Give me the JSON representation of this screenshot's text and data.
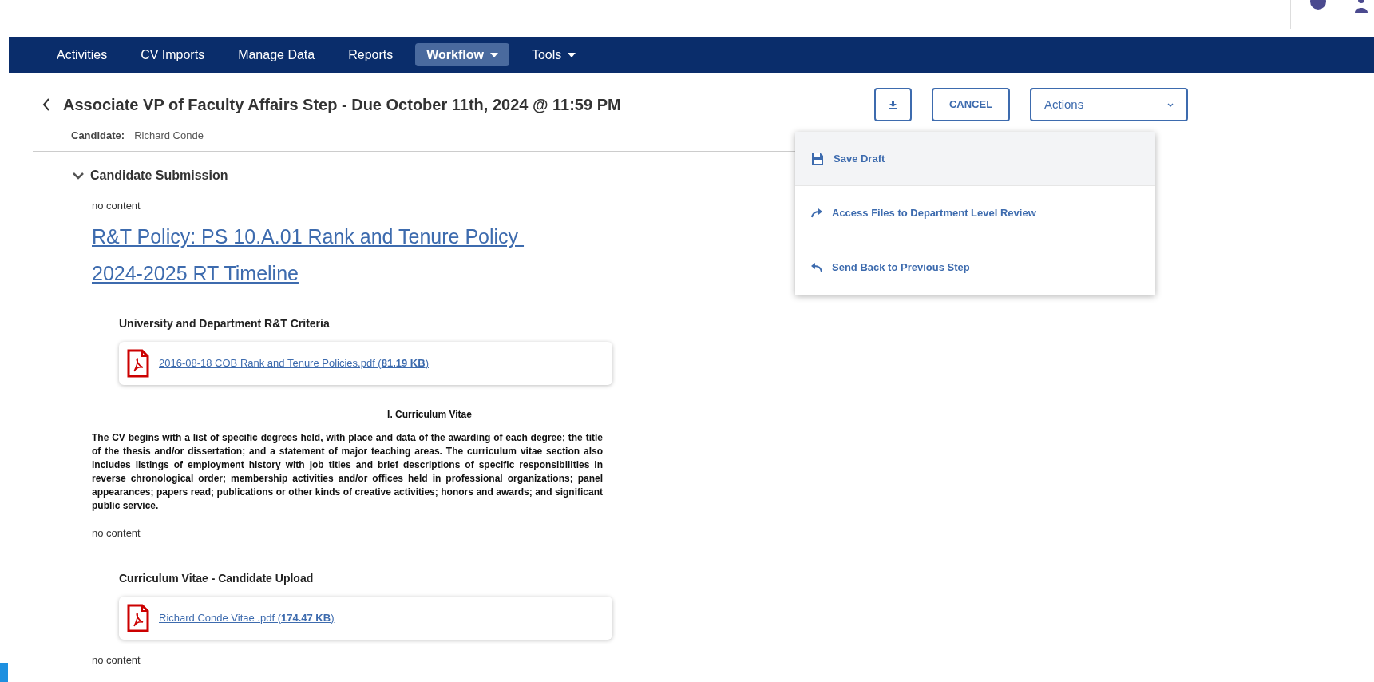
{
  "nav": {
    "items": [
      {
        "label": "Activities",
        "selected": false,
        "dropdown": false
      },
      {
        "label": "CV Imports",
        "selected": false,
        "dropdown": false
      },
      {
        "label": "Manage Data",
        "selected": false,
        "dropdown": false
      },
      {
        "label": "Reports",
        "selected": false,
        "dropdown": false
      },
      {
        "label": "Workflow",
        "selected": true,
        "dropdown": true
      },
      {
        "label": "Tools",
        "selected": false,
        "dropdown": true
      }
    ]
  },
  "header": {
    "title": "Associate VP of Faculty Affairs Step - Due October 11th, 2024 @ 11:59 PM",
    "candidate_label": "Candidate:",
    "candidate_name": "Richard Conde"
  },
  "toolbar": {
    "cancel": "CANCEL",
    "actions": "Actions"
  },
  "actions_menu": {
    "open": true,
    "items": [
      {
        "kind": "save",
        "label": "Save Draft",
        "selected": true
      },
      {
        "kind": "forward",
        "label": "Access Files to Department Level Review",
        "selected": false
      },
      {
        "kind": "back",
        "label": "Send Back to Previous Step",
        "selected": false
      }
    ]
  },
  "section": {
    "title": "Candidate Submission",
    "expanded": true,
    "blocks": [
      {
        "kind": "note",
        "text": "no content"
      },
      {
        "kind": "link",
        "text": "R&T Policy: PS 10.A.01 Rank and Tenure Policy "
      },
      {
        "kind": "link",
        "text": "2024-2025 RT Timeline"
      },
      {
        "kind": "file",
        "title": "University and Department R&T Criteria",
        "file_name": "2016-08-18 COB Rank and Tenure Policies.pdf (",
        "size": "81.19 KB",
        "close": ")"
      },
      {
        "kind": "heading",
        "text": "I. Curriculum Vitae"
      },
      {
        "kind": "paragraph",
        "text": "The CV begins with a list of specific degrees held, with place and data of the awarding of each degree; the title of the thesis and/or dissertation; and a statement of major teaching areas. The curriculum vitae section also includes listings of employment history with job titles and brief descriptions of specific responsibilities in reverse chronological order; membership activities and/or offices held in professional organizations; panel appearances; papers read; publications or other kinds of creative activities; honors and awards; and significant public service."
      },
      {
        "kind": "note",
        "text": "no content"
      },
      {
        "kind": "file",
        "title": "Curriculum Vitae - Candidate Upload",
        "file_name": "Richard Conde Vitae .pdf (",
        "size": "174.47 KB",
        "close": ")"
      },
      {
        "kind": "note",
        "text": "no content"
      }
    ]
  }
}
